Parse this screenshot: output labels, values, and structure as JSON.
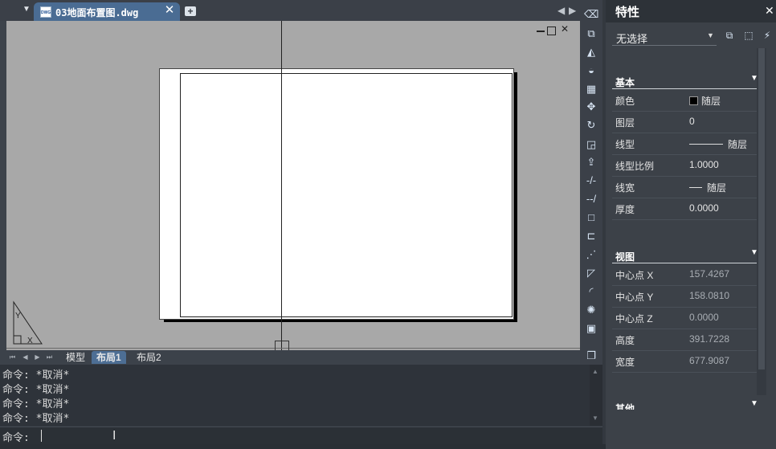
{
  "tabbar": {
    "doc_tab_label": "03地面布置图.dwg",
    "dwg_badge": "DWG",
    "close_glyph": "✕",
    "new_tab_glyph": "+"
  },
  "layout_tabs": {
    "model": "模型",
    "layout1": "布局1",
    "layout2": "布局2"
  },
  "command": {
    "history": [
      "命令: *取消*",
      "命令: *取消*",
      "命令: *取消*",
      "命令: *取消*"
    ],
    "prompt": "命令:"
  },
  "properties": {
    "title": "特性",
    "selection": "无选择",
    "sections": {
      "basic": "基本",
      "view": "视图",
      "other": "其他"
    },
    "basic_rows": [
      {
        "label": "颜色",
        "value": "随层"
      },
      {
        "label": "图层",
        "value": "0"
      },
      {
        "label": "线型",
        "value": "随层"
      },
      {
        "label": "线型比例",
        "value": "1.0000"
      },
      {
        "label": "线宽",
        "value": "随层"
      },
      {
        "label": "厚度",
        "value": "0.0000"
      }
    ],
    "view_rows": [
      {
        "label": "中心点 X",
        "value": "157.4267"
      },
      {
        "label": "中心点 Y",
        "value": "158.0810"
      },
      {
        "label": "中心点 Z",
        "value": "0.0000"
      },
      {
        "label": "高度",
        "value": "391.7228"
      },
      {
        "label": "宽度",
        "value": "677.9087"
      }
    ]
  },
  "colors": {
    "accent_tab": "#4a6c93",
    "canvas_bg": "#a8a8a8",
    "panel_bg": "#3c4148"
  },
  "icons": [
    "eraser-icon",
    "copy-icon",
    "mirror-icon",
    "offset-icon",
    "array-icon",
    "move-icon",
    "rotate-icon",
    "scale-icon",
    "stretch-icon",
    "trim-icon",
    "extend-icon",
    "break-icon",
    "join-icon",
    "chamfer-icon",
    "fillet-icon",
    "blend-icon",
    "explode-icon",
    "properties-match-icon",
    "layer-icon"
  ]
}
